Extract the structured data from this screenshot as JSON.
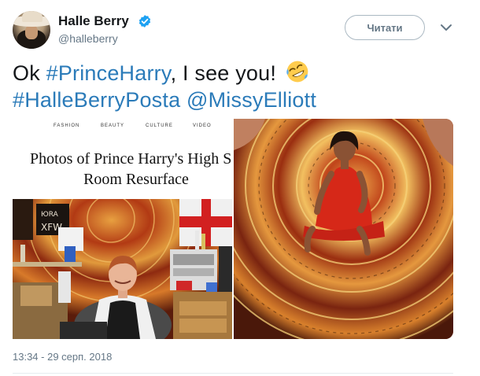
{
  "user": {
    "name": "Halle Berry",
    "handle": "@halleberry",
    "verified": true
  },
  "actions": {
    "follow_label": "Читати",
    "more_icon": "chevron-down-icon"
  },
  "tweet": {
    "line1_prefix": "Ok ",
    "hashtag_prince": "#PrinceHarry",
    "line1_suffix": ", I see you!",
    "emoji": "rolling-on-floor-laughing",
    "hashtag_posta": "#HalleBerryPosta",
    "mention": "@MissyElliott"
  },
  "media": {
    "left_photo": {
      "nav": [
        "FASHION",
        "BEAUTY",
        "CULTURE",
        "VIDEO"
      ],
      "title_line1": "Photos of Prince Harry's High School Do",
      "title_line2": "Room Resurface"
    },
    "right_photo": {}
  },
  "timestamp": "13:34 - 29 серп. 2018",
  "colors": {
    "link": "#2b7bb9",
    "secondary": "#657786",
    "verified": "#1da1f2"
  }
}
